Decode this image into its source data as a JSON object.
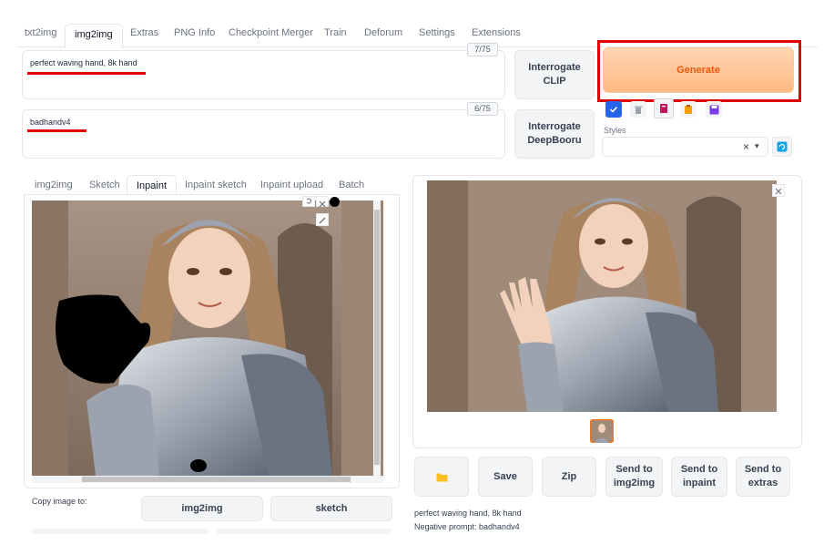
{
  "top_tabs": [
    "txt2img",
    "img2img",
    "Extras",
    "PNG Info",
    "Checkpoint Merger",
    "Train",
    "Deforum",
    "Settings",
    "Extensions"
  ],
  "prompt": {
    "text": "perfect waving hand, 8k hand",
    "token_count": "7/75"
  },
  "negative_prompt": {
    "text": "badhandv4",
    "token_count": "6/75"
  },
  "interrogate_clip": {
    "line1": "Interrogate",
    "line2": "CLIP"
  },
  "interrogate_deepbooru": {
    "line1": "Interrogate",
    "line2": "DeepBooru"
  },
  "generate_label": "Generate",
  "styles": {
    "label": "Styles",
    "clear": "×",
    "caret": "▾"
  },
  "sub_tabs": [
    "img2img",
    "Sketch",
    "Inpaint",
    "Inpaint sketch",
    "Inpaint upload",
    "Batch"
  ],
  "copy_image_to": {
    "label": "Copy image to:",
    "buttons": [
      "img2img",
      "sketch"
    ]
  },
  "output_buttons": [
    {
      "l1": "Save",
      "l2": ""
    },
    {
      "l1": "Zip",
      "l2": ""
    },
    {
      "l1": "Send to",
      "l2": "img2img"
    },
    {
      "l1": "Send to",
      "l2": "inpaint"
    },
    {
      "l1": "Send to",
      "l2": "extras"
    }
  ],
  "output_info": {
    "prompt_line": "perfect waving hand, 8k hand",
    "negative_line": "Negative prompt: badhandv4"
  },
  "icons": [
    "folder-icon",
    "checkbox-icon",
    "trash-icon",
    "book-icon",
    "clipboard-icon",
    "save-icon",
    "refresh-icon",
    "close-icon",
    "brush-icon",
    "undo-icon"
  ],
  "colors": {
    "accent_orange": "#ea580c",
    "highlight_red": "#e00000",
    "generate_bg": "#fdba84"
  }
}
